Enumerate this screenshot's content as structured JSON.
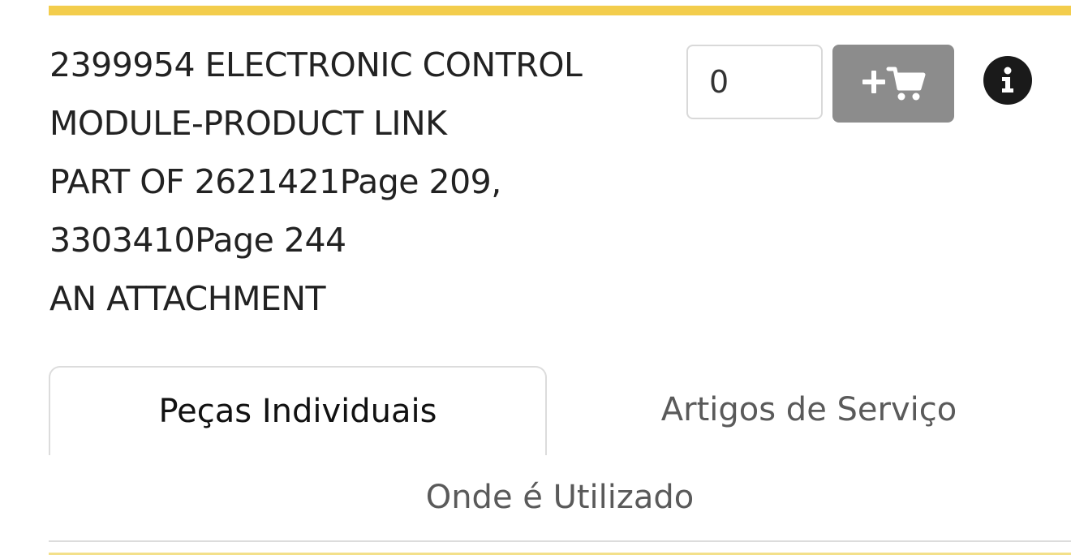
{
  "part": {
    "lines": [
      "2399954 ELECTRONIC CONTROL",
      "MODULE-PRODUCT LINK",
      "PART OF 2621421Page 209,",
      "3303410Page 244",
      "AN ATTACHMENT"
    ]
  },
  "quantity": {
    "value": "0"
  },
  "actions": {
    "cart_icon": "add-to-cart-icon",
    "info_icon": "info-icon"
  },
  "tabs": [
    {
      "label": "Peças Individuais",
      "active": true
    },
    {
      "label": "Artigos de Serviço",
      "active": false
    },
    {
      "label": "Onde é Utilizado",
      "active": false
    }
  ],
  "colors": {
    "accent": "#f3cd4c",
    "cart_button": "#8c8c8c",
    "info_button": "#1a1a1a"
  }
}
